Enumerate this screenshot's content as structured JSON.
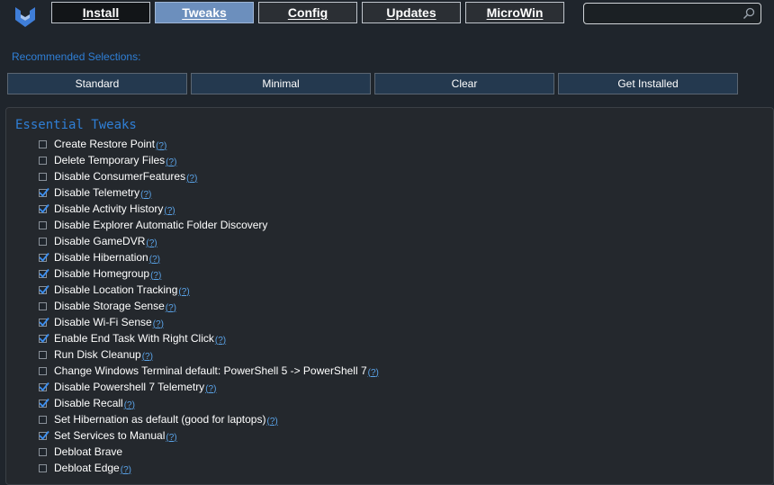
{
  "nav": {
    "install": "Install",
    "tweaks": "Tweaks",
    "config": "Config",
    "updates": "Updates",
    "microwin": "MicroWin"
  },
  "search": {
    "value": "",
    "placeholder": ""
  },
  "recommended": {
    "label": "Recommended Selections:",
    "buttons": [
      "Standard",
      "Minimal",
      "Clear",
      "Get Installed"
    ]
  },
  "section": {
    "title": "Essential Tweaks",
    "help_text": "(?)",
    "items": [
      {
        "label": "Create Restore Point",
        "checked": false,
        "help": true
      },
      {
        "label": "Delete Temporary Files",
        "checked": false,
        "help": true
      },
      {
        "label": "Disable ConsumerFeatures",
        "checked": false,
        "help": true
      },
      {
        "label": "Disable Telemetry",
        "checked": true,
        "help": true
      },
      {
        "label": "Disable Activity History",
        "checked": true,
        "help": true
      },
      {
        "label": "Disable Explorer Automatic Folder Discovery",
        "checked": false,
        "help": false
      },
      {
        "label": "Disable GameDVR",
        "checked": false,
        "help": true
      },
      {
        "label": "Disable Hibernation",
        "checked": true,
        "help": true
      },
      {
        "label": "Disable Homegroup",
        "checked": true,
        "help": true
      },
      {
        "label": "Disable Location Tracking",
        "checked": true,
        "help": true
      },
      {
        "label": "Disable Storage Sense",
        "checked": false,
        "help": true
      },
      {
        "label": "Disable Wi-Fi Sense",
        "checked": true,
        "help": true
      },
      {
        "label": "Enable End Task With Right Click",
        "checked": true,
        "help": true
      },
      {
        "label": "Run Disk Cleanup",
        "checked": false,
        "help": true
      },
      {
        "label": "Change Windows Terminal default: PowerShell 5 -> PowerShell 7",
        "checked": false,
        "help": true
      },
      {
        "label": "Disable Powershell 7 Telemetry",
        "checked": true,
        "help": true
      },
      {
        "label": "Disable Recall",
        "checked": true,
        "help": true
      },
      {
        "label": "Set Hibernation as default (good for laptops)",
        "checked": false,
        "help": true
      },
      {
        "label": "Set Services to Manual",
        "checked": true,
        "help": true
      },
      {
        "label": "Debloat Brave",
        "checked": false,
        "help": false
      },
      {
        "label": "Debloat Edge",
        "checked": false,
        "help": true
      }
    ]
  },
  "colors": {
    "accent": "#2f7fd6",
    "active_tab": "#6c8fbd",
    "check": "#3d8ff0"
  }
}
